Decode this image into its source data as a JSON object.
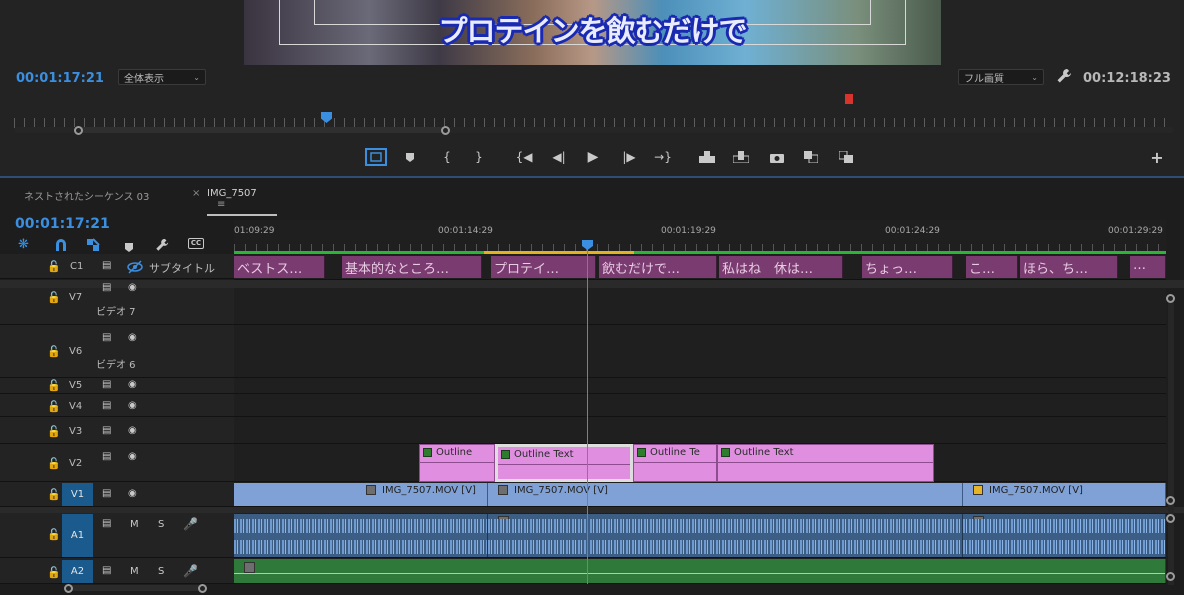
{
  "monitor": {
    "caption_overlay": "プロテインを飲むだけで",
    "current_timecode": "00:01:17:21",
    "zoom_select": "全体表示",
    "quality_select": "フル画質",
    "duration_timecode": "00:12:18:23",
    "controls": [
      "safe-margins",
      "add-marker",
      "mark-in",
      "mark-out",
      "go-to-in",
      "step-back",
      "play",
      "step-forward",
      "go-to-out",
      "insert",
      "overwrite",
      "export-frame",
      "comparison-view",
      "toggle-proxy",
      "add-button"
    ]
  },
  "timeline": {
    "tabs": [
      {
        "label": "ネストされたシーケンス 03",
        "active": false
      },
      {
        "label": "IMG_7507",
        "active": true
      }
    ],
    "current_timecode": "00:01:17:21",
    "ruler_labels": [
      "01:09:29",
      "00:01:14:29",
      "00:01:19:29",
      "00:01:24:29",
      "00:01:29:29"
    ],
    "tracks": {
      "c1": {
        "name": "C1",
        "label": "サブタイトル"
      },
      "v7": {
        "name": "V7",
        "label": "ビデオ 7"
      },
      "v6": {
        "name": "V6",
        "label": "ビデオ 6"
      },
      "v5": {
        "name": "V5"
      },
      "v4": {
        "name": "V4"
      },
      "v3": {
        "name": "V3"
      },
      "v2": {
        "name": "V2"
      },
      "v1": {
        "name": "V1"
      },
      "a1": {
        "name": "A1",
        "m": "M",
        "s": "S"
      },
      "a2": {
        "name": "A2",
        "m": "M",
        "s": "S"
      }
    },
    "captions": [
      "ベストス…",
      "基本的なところ…",
      "プロテイ…",
      "飲むだけで…",
      "私はね　休は…",
      "ちょっ…",
      "こ…",
      "ほら、ち…",
      "…"
    ],
    "graphics_clips": [
      "Outline",
      "Outline Text",
      "Outline Te",
      "Outline Text"
    ],
    "video_clips": [
      "IMG_7507.MOV [V]",
      "IMG_7507.MOV [V]",
      "IMG_7507.MOV [V]"
    ]
  }
}
